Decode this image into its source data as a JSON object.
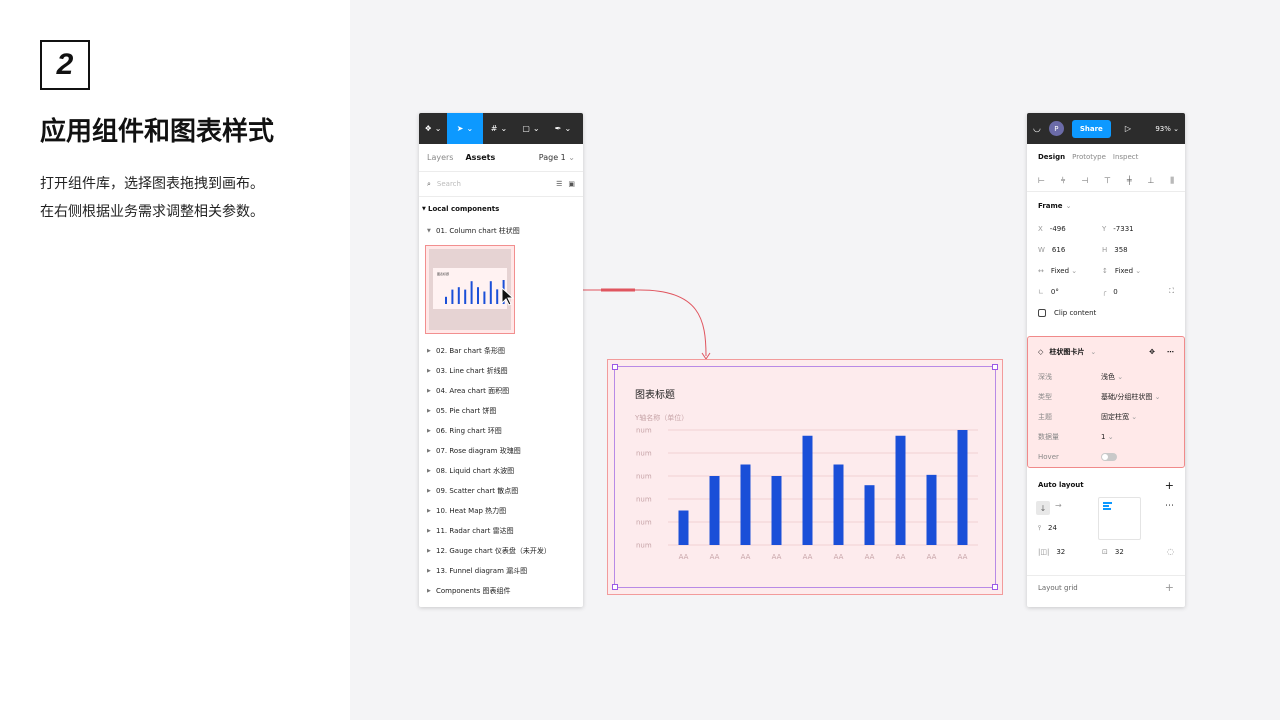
{
  "step": {
    "number": "2"
  },
  "heading": {
    "title": "应用组件和图表样式"
  },
  "description": {
    "line1": "打开组件库，选择图表拖拽到画布。",
    "line2": "在右侧根据业务需求调整相关参数。"
  },
  "assets_panel": {
    "tabs": [
      "Layers",
      "Assets"
    ],
    "active_tab": "Assets",
    "page_selector": "Page 1",
    "search_placeholder": "Search",
    "section_title": "Local components",
    "open_item": "01. Column chart 柱状图",
    "items": [
      "02. Bar chart 条形图",
      "03. Line chart 折线图",
      "04. Area chart 面积图",
      "05. Pie chart 饼图",
      "06. Ring chart 环图",
      "07. Rose diagram 玫瑰图",
      "08. Liquid chart 水波图",
      "09. Scatter chart 散点图",
      "10. Heat Map 热力图",
      "11. Radar chart 雷达图",
      "12. Gauge chart 仪表盘（未开发）",
      "13. Funnel diagram 漏斗图",
      "Components 图表组件"
    ],
    "thumbnail_title": "图表标题"
  },
  "properties_panel": {
    "avatar_initial": "P",
    "share_label": "Share",
    "zoom": "93%",
    "tabs": [
      "Design",
      "Prototype",
      "Inspect"
    ],
    "active_tab": "Design",
    "frame_section": "Frame",
    "x_label": "X",
    "x_value": "-496",
    "y_label": "Y",
    "y_value": "-7331",
    "w_label": "W",
    "w_value": "616",
    "h_label": "H",
    "h_value": "358",
    "width_mode": "Fixed",
    "height_mode": "Fixed",
    "rotation": "0°",
    "radius": "0",
    "clip_content": "Clip content",
    "variant_title": "柱状图卡片",
    "variant_props": [
      {
        "key": "深浅",
        "value": "浅色"
      },
      {
        "key": "类型",
        "value": "基础/分组柱状图"
      },
      {
        "key": "主题",
        "value": "固定柱宽"
      },
      {
        "key": "数据量",
        "value": "1"
      },
      {
        "key": "Hover",
        "value": ""
      }
    ],
    "auto_layout_title": "Auto layout",
    "spacing": "24",
    "padding_h": "32",
    "padding_v": "32",
    "layout_grid_title": "Layout grid"
  },
  "chart_data": {
    "type": "bar",
    "title": "图表标题",
    "ylabel": "Y轴名称（单位）",
    "categories": [
      "AA",
      "AA",
      "AA",
      "AA",
      "AA",
      "AA",
      "AA",
      "AA",
      "AA",
      "AA"
    ],
    "values": [
      30,
      60,
      70,
      60,
      95,
      70,
      52,
      95,
      61,
      100
    ],
    "ylim": [
      0,
      100
    ],
    "y_tick_labels": [
      "num",
      "num",
      "num",
      "num",
      "num",
      "num"
    ],
    "bar_color": "#1a4fd8",
    "grid": true
  },
  "colors": {
    "accent": "#0d99ff",
    "selection": "#f08a8a",
    "frame_bg": "#fdebed",
    "toolbar": "#2c2c2c"
  }
}
